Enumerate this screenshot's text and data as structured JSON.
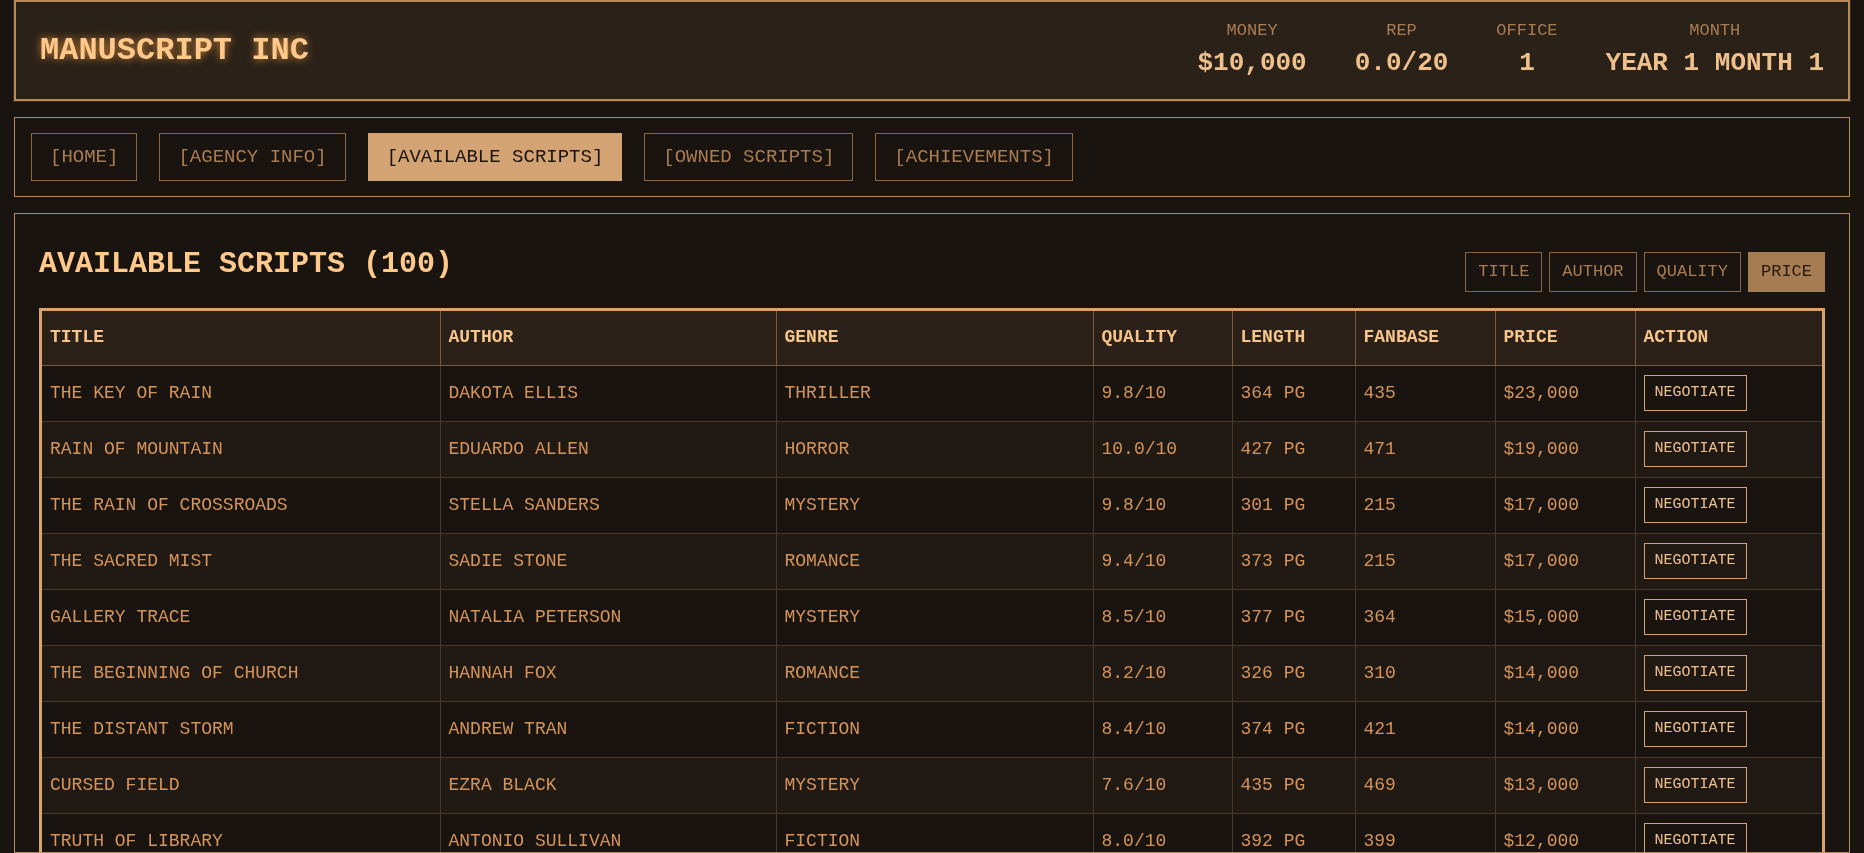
{
  "header": {
    "title": "MANUSCRIPT INC",
    "stats": [
      {
        "label": "MONEY",
        "value": "$10,000"
      },
      {
        "label": "REP",
        "value": "0.0/20"
      },
      {
        "label": "OFFICE",
        "value": "1"
      },
      {
        "label": "MONTH",
        "value": "YEAR 1 MONTH 1"
      }
    ]
  },
  "tabs": [
    {
      "label": "[HOME]",
      "selected": false
    },
    {
      "label": "[AGENCY INFO]",
      "selected": false
    },
    {
      "label": "[AVAILABLE SCRIPTS]",
      "selected": true
    },
    {
      "label": "[OWNED SCRIPTS]",
      "selected": false
    },
    {
      "label": "[ACHIEVEMENTS]",
      "selected": false
    }
  ],
  "panel": {
    "title": "AVAILABLE SCRIPTS (100)",
    "sort_buttons": [
      {
        "label": "TITLE",
        "selected": false
      },
      {
        "label": "AUTHOR",
        "selected": false
      },
      {
        "label": "QUALITY",
        "selected": false
      },
      {
        "label": "PRICE",
        "selected": true
      }
    ]
  },
  "table": {
    "columns": [
      "TITLE",
      "AUTHOR",
      "GENRE",
      "QUALITY",
      "LENGTH",
      "FANBASE",
      "PRICE",
      "ACTION"
    ],
    "rows": [
      {
        "cells": [
          "THE KEY OF RAIN",
          "DAKOTA ELLIS",
          "THRILLER",
          "9.8/10",
          "364 PG",
          "435",
          "$23,000"
        ],
        "action": "NEGOTIATE"
      },
      {
        "cells": [
          "RAIN OF MOUNTAIN",
          "EDUARDO ALLEN",
          "HORROR",
          "10.0/10",
          "427 PG",
          "471",
          "$19,000"
        ],
        "action": "NEGOTIATE"
      },
      {
        "cells": [
          "THE RAIN OF CROSSROADS",
          "STELLA SANDERS",
          "MYSTERY",
          "9.8/10",
          "301 PG",
          "215",
          "$17,000"
        ],
        "action": "NEGOTIATE"
      },
      {
        "cells": [
          "THE SACRED MIST",
          "SADIE STONE",
          "ROMANCE",
          "9.4/10",
          "373 PG",
          "215",
          "$17,000"
        ],
        "action": "NEGOTIATE"
      },
      {
        "cells": [
          "GALLERY TRACE",
          "NATALIA PETERSON",
          "MYSTERY",
          "8.5/10",
          "377 PG",
          "364",
          "$15,000"
        ],
        "action": "NEGOTIATE"
      },
      {
        "cells": [
          "THE BEGINNING OF CHURCH",
          "HANNAH FOX",
          "ROMANCE",
          "8.2/10",
          "326 PG",
          "310",
          "$14,000"
        ],
        "action": "NEGOTIATE"
      },
      {
        "cells": [
          "THE DISTANT STORM",
          "ANDREW TRAN",
          "FICTION",
          "8.4/10",
          "374 PG",
          "421",
          "$14,000"
        ],
        "action": "NEGOTIATE"
      },
      {
        "cells": [
          "CURSED FIELD",
          "EZRA BLACK",
          "MYSTERY",
          "7.6/10",
          "435 PG",
          "469",
          "$13,000"
        ],
        "action": "NEGOTIATE"
      },
      {
        "cells": [
          "TRUTH OF LIBRARY",
          "ANTONIO SULLIVAN",
          "FICTION",
          "8.0/10",
          "392 PG",
          "399",
          "$12,000"
        ],
        "action": "NEGOTIATE"
      }
    ]
  }
}
